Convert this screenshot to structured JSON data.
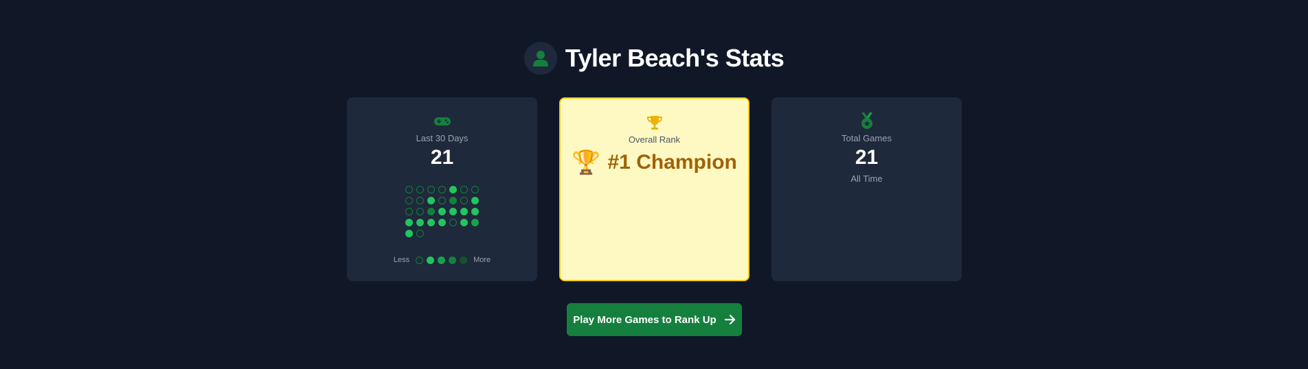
{
  "header": {
    "title": "Tyler Beach's Stats",
    "avatar_icon": "user-icon"
  },
  "cards": {
    "recent": {
      "icon": "gamepad-icon",
      "label": "Last 30 Days",
      "value": "21",
      "activity_levels": [
        0,
        0,
        0,
        0,
        1,
        0,
        0,
        0,
        0,
        1,
        0,
        3,
        0,
        1,
        0,
        0,
        3,
        1,
        1,
        1,
        1,
        1,
        1,
        1,
        1,
        0,
        1,
        2,
        1,
        0
      ],
      "legend": {
        "less": "Less",
        "more": "More",
        "levels": [
          0,
          1,
          2,
          3,
          4
        ]
      }
    },
    "rank": {
      "icon": "trophy-icon",
      "label": "Overall Rank",
      "emoji": "🏆",
      "value": "#1 Champion"
    },
    "total": {
      "icon": "medal-icon",
      "label": "Total Games",
      "value": "21",
      "sub": "All Time"
    }
  },
  "cta": {
    "label": "Play More Games to Rank Up",
    "icon": "arrow-right-icon"
  },
  "colors": {
    "background": "#101828",
    "card": "#1e293b",
    "accent_green": "#15803d",
    "rank_bg": "#fef9c3",
    "rank_border": "#facc15",
    "rank_text": "#a16207"
  }
}
